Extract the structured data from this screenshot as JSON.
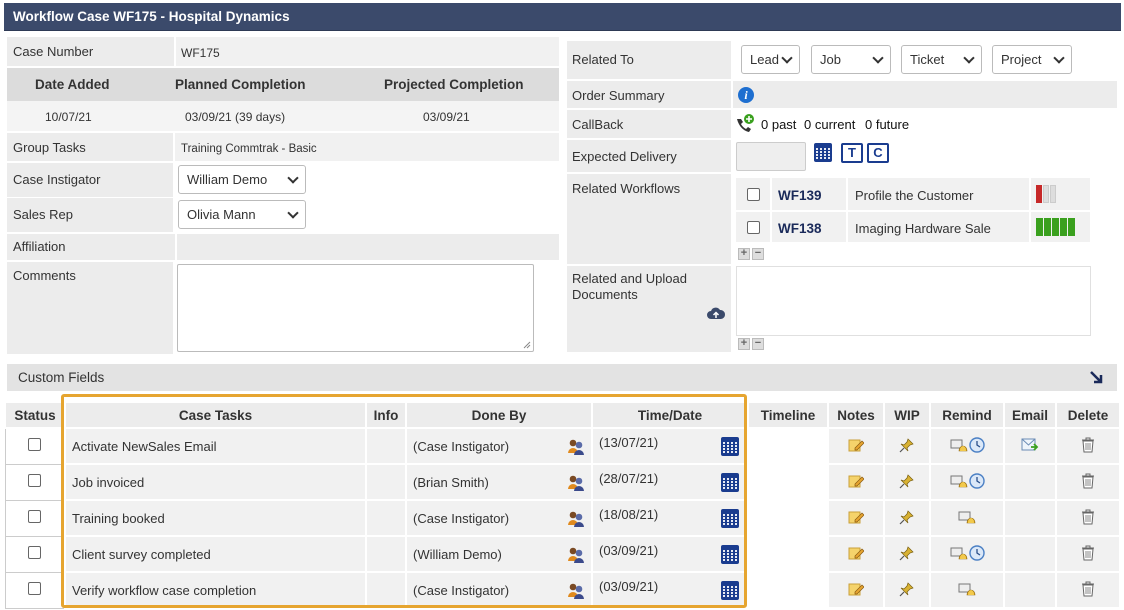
{
  "window": {
    "title": "Workflow Case WF175 - Hospital Dynamics"
  },
  "left": {
    "case_number_label": "Case Number",
    "case_number_value": "WF175",
    "headers": {
      "date_added": "Date Added",
      "planned": "Planned Completion",
      "projected": "Projected Completion"
    },
    "values": {
      "date_added": "10/07/21",
      "planned": "03/09/21 (39 days)",
      "projected": "03/09/21"
    },
    "group_tasks_label": "Group Tasks",
    "group_tasks_value": "Training Commtrak - Basic",
    "instigator_label": "Case Instigator",
    "instigator_value": "William Demo",
    "sales_rep_label": "Sales Rep",
    "sales_rep_value": "Olivia Mann",
    "affiliation_label": "Affiliation",
    "comments_label": "Comments"
  },
  "right": {
    "related_to_label": "Related To",
    "related_selects": [
      "Lead",
      "Job",
      "Ticket",
      "Project"
    ],
    "order_summary_label": "Order Summary",
    "callback_label": "CallBack",
    "callback": {
      "past": "0 past",
      "current": "0 current",
      "future": "0 future"
    },
    "expected_delivery_label": "Expected Delivery",
    "tag_t": "T",
    "tag_c": "C",
    "related_workflows_label": "Related Workflows",
    "workflows": [
      {
        "id": "WF139",
        "name": "Profile the Customer",
        "progress": 0.2
      },
      {
        "id": "WF138",
        "name": "Imaging Hardware Sale",
        "progress": 1.0
      }
    ],
    "documents_label": "Related and Upload Documents"
  },
  "custom_fields_label": "Custom Fields",
  "tasks": {
    "headers": [
      "Status",
      "Case Tasks",
      "Info",
      "Done By",
      "Time/Date",
      "Timeline",
      "Notes",
      "WIP",
      "Remind",
      "Email",
      "Delete"
    ],
    "rows": [
      {
        "task": "Activate NewSales Email",
        "done_by": "(Case Instigator)",
        "date": "(13/07/21)",
        "clock": true,
        "email": true
      },
      {
        "task": "Job invoiced",
        "done_by": "(Brian Smith)",
        "date": "(28/07/21)",
        "clock": true,
        "email": false
      },
      {
        "task": "Training booked",
        "done_by": "(Case Instigator)",
        "date": "(18/08/21)",
        "clock": false,
        "email": false
      },
      {
        "task": "Client survey completed",
        "done_by": "(William Demo)",
        "date": "(03/09/21)",
        "clock": true,
        "email": false
      },
      {
        "task": "Verify workflow case completion",
        "done_by": "(Case Instigator)",
        "date": "(03/09/21)",
        "clock": false,
        "email": false
      }
    ]
  },
  "colors": {
    "title_bar": "#3b4a6b",
    "highlight": "#e6a530",
    "green": "#3aa01e",
    "red": "#c62828"
  }
}
